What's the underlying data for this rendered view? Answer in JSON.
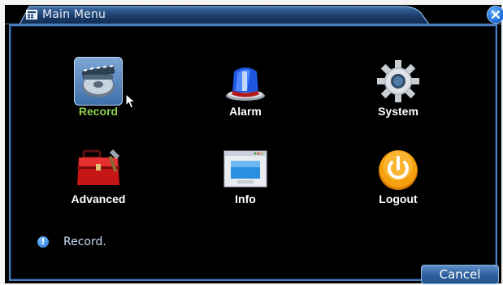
{
  "window": {
    "title": "Main Menu"
  },
  "menu": {
    "items": [
      {
        "label": "Record",
        "icon": "record-icon",
        "selected": true
      },
      {
        "label": "Alarm",
        "icon": "alarm-icon",
        "selected": false
      },
      {
        "label": "System",
        "icon": "system-gear-icon",
        "selected": false
      },
      {
        "label": "Advanced",
        "icon": "toolbox-icon",
        "selected": false
      },
      {
        "label": "Info",
        "icon": "info-screen-icon",
        "selected": false
      },
      {
        "label": "Logout",
        "icon": "power-icon",
        "selected": false
      }
    ]
  },
  "status": {
    "text": "Record."
  },
  "buttons": {
    "cancel": "Cancel"
  },
  "colors": {
    "accent": "#4c7fb8",
    "selected_label": "#8fd14f",
    "background": "#000000"
  }
}
